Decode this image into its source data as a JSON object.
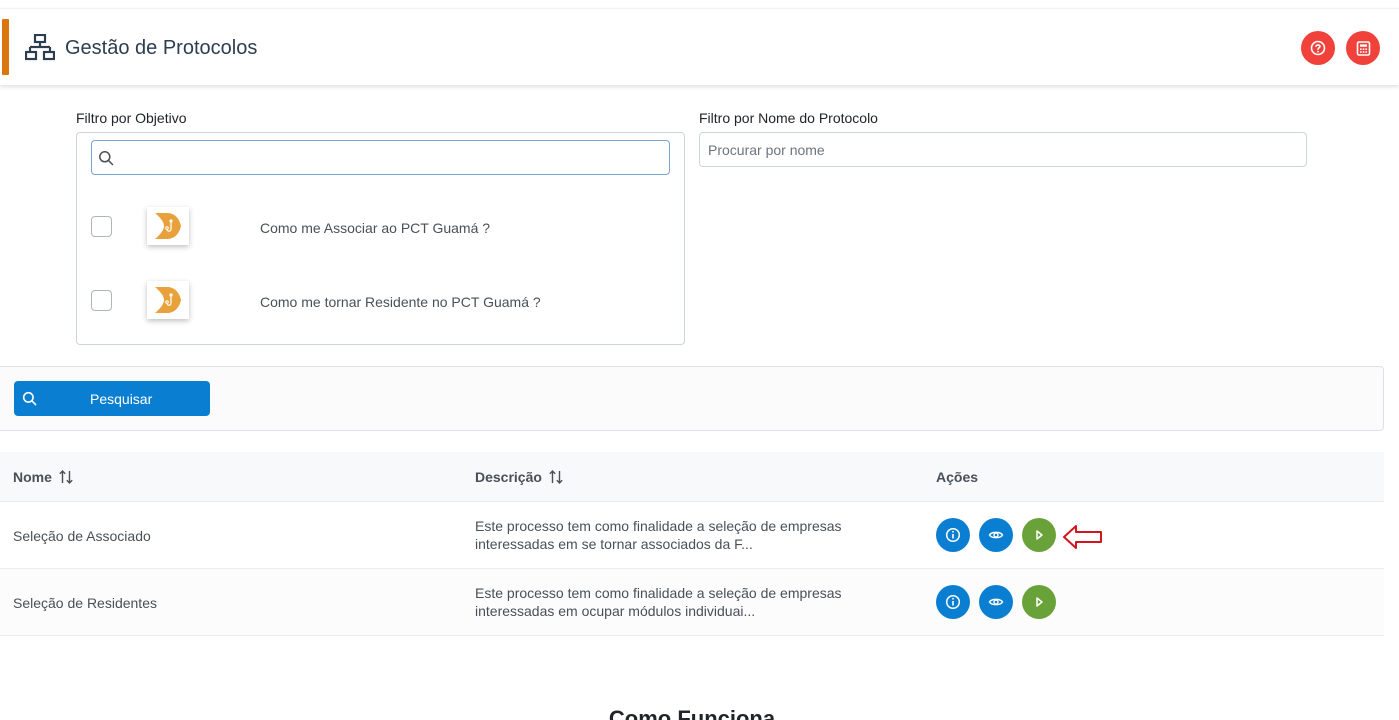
{
  "header": {
    "title": "Gestão de Protocolos",
    "icon": "sitemap-icon",
    "accent_color": "#d9760d",
    "action_color": "#f0413b"
  },
  "filters": {
    "objective_label": "Filtro por Objetivo",
    "objective_search_value": "",
    "objectives": [
      {
        "label": "Como me Associar ao PCT Guamá ?",
        "checked": false
      },
      {
        "label": "Como me tornar Residente no PCT Guamá ?",
        "checked": false
      }
    ],
    "name_label": "Filtro por Nome do Protocolo",
    "name_placeholder": "Procurar por nome",
    "name_value": ""
  },
  "search_button": {
    "label": "Pesquisar",
    "color": "#0a7fd1"
  },
  "table": {
    "columns": [
      "Nome",
      "Descrição",
      "Ações"
    ],
    "rows": [
      {
        "name": "Seleção de Associado",
        "desc_line1": "Este processo tem como finalidade a seleção de empresas",
        "desc_line2": "interessadas em se tornar associados da F..."
      },
      {
        "name": "Seleção de Residentes",
        "desc_line1": "Este processo tem como finalidade a seleção de empresas",
        "desc_line2": "interessadas em ocupar módulos individuai..."
      }
    ],
    "action_colors": {
      "info": "#0a7fd1",
      "view": "#0a7fd1",
      "start": "#6aa23a"
    }
  },
  "section": {
    "title": "Como Funciona"
  }
}
